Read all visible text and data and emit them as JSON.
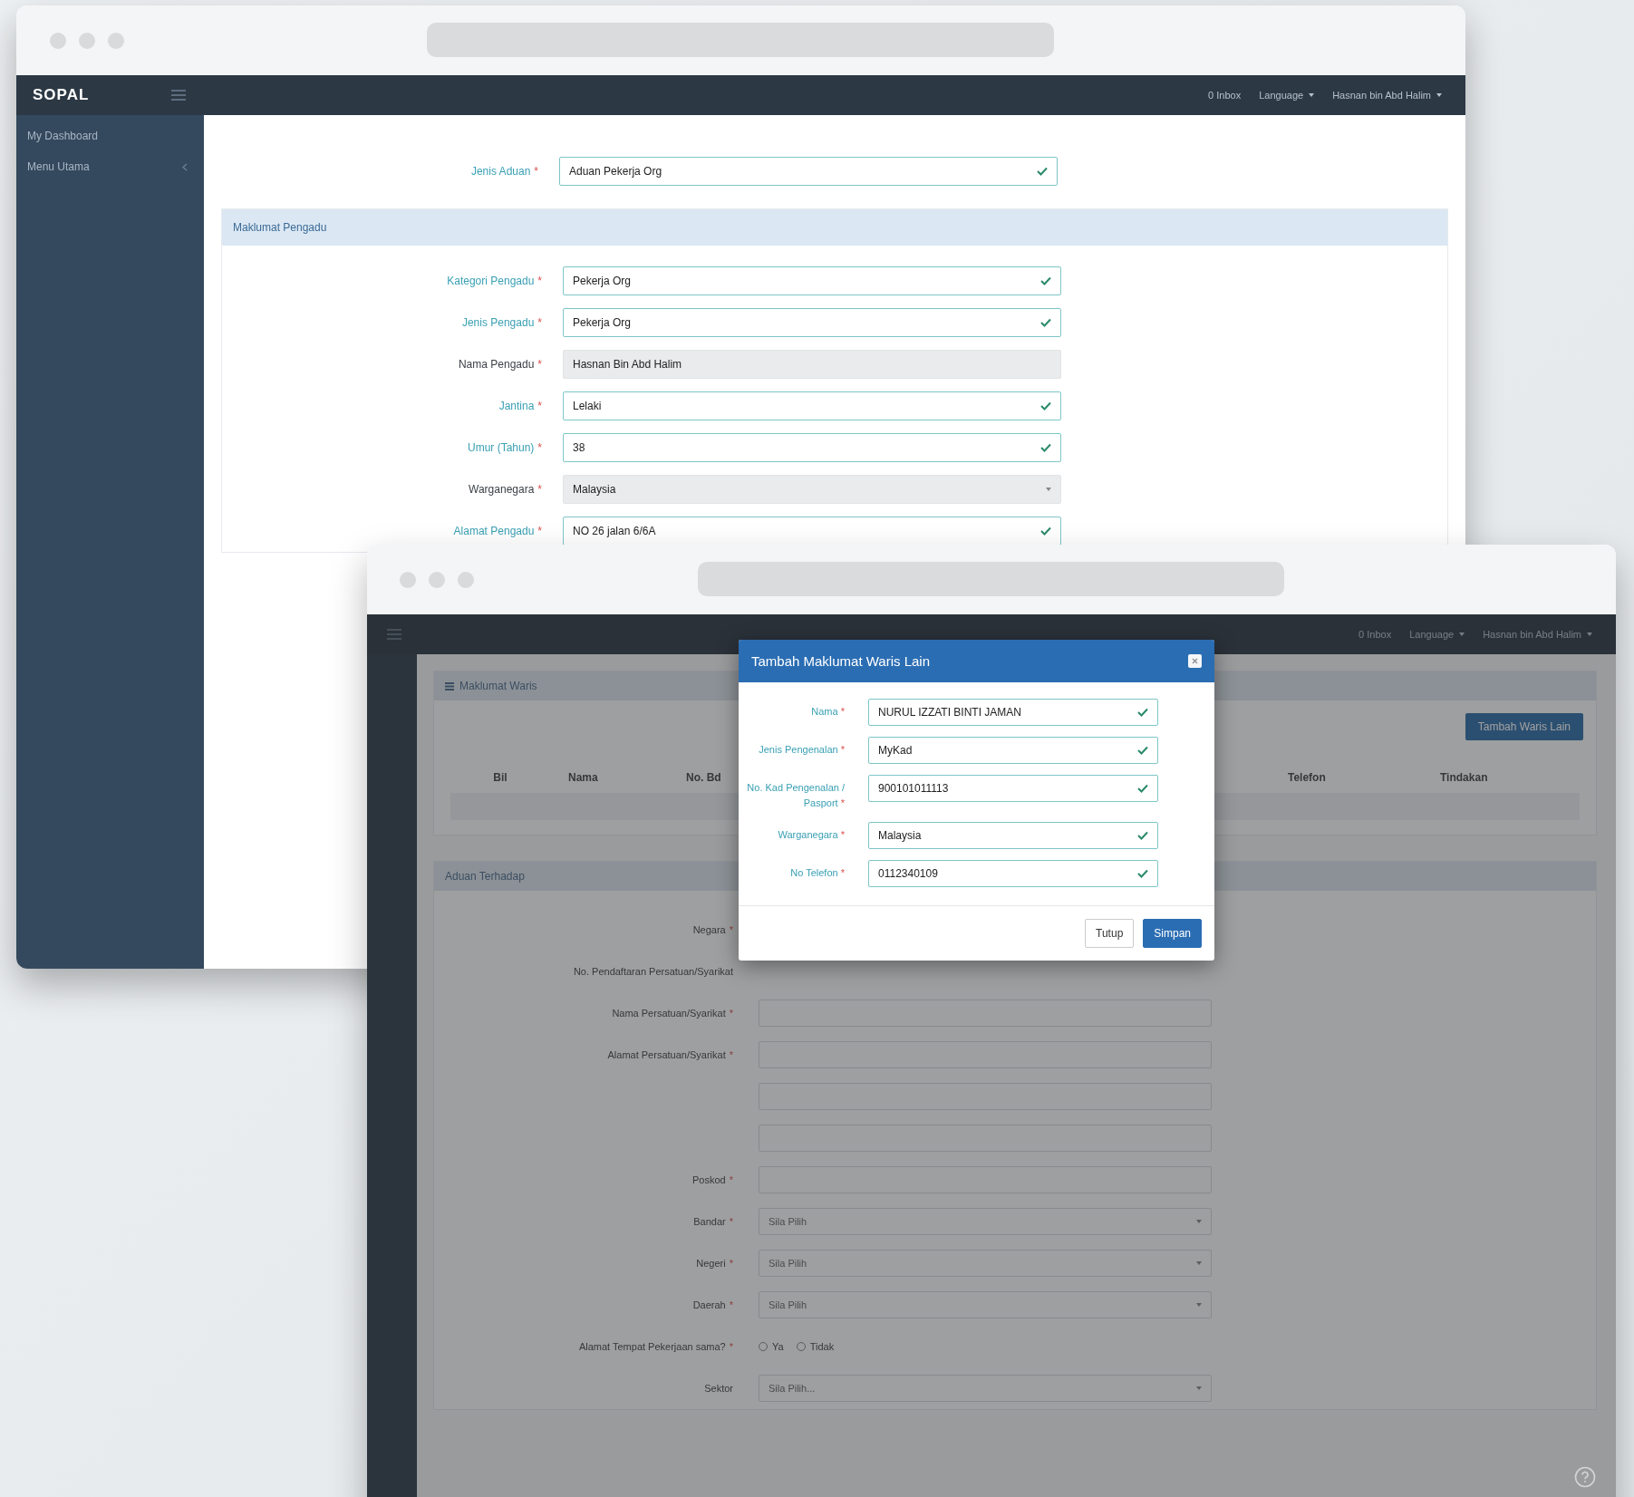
{
  "back_window": {
    "logo": "SOPAL",
    "nav": [
      {
        "label": "0 Inbox",
        "dropdown": false
      },
      {
        "label": "Language",
        "dropdown": true
      },
      {
        "label": "Hasnan bin Abd Halim",
        "dropdown": true
      }
    ],
    "sidebar": [
      {
        "label": "My Dashboard",
        "expandable": false
      },
      {
        "label": "Menu Utama",
        "expandable": true
      }
    ],
    "top_field": {
      "label": "Jenis Aduan",
      "mark": "*",
      "valid": true,
      "value": "Aduan Pekerja Org"
    },
    "section_title": "Maklumat Pengadu",
    "fields": [
      {
        "label": "Kategori Pengadu",
        "mark": "*",
        "valid": true,
        "value": "Pekerja Org"
      },
      {
        "label": "Jenis Pengadu",
        "mark": "*",
        "valid": true,
        "value": "Pekerja Org"
      },
      {
        "label": "Nama Pengadu",
        "mark": "*",
        "valid": false,
        "value": "Hasnan Bin Abd Halim"
      },
      {
        "label": "Jantina",
        "mark": "*",
        "valid": true,
        "value": "Lelaki"
      },
      {
        "label": "Umur (Tahun)",
        "mark": "*",
        "valid": true,
        "value": "38"
      },
      {
        "label": "Warganegara",
        "mark": "*",
        "valid": false,
        "dropdown": true,
        "value": "Malaysia"
      },
      {
        "label": "Alamat Pengadu",
        "mark": "*",
        "valid": true,
        "value": "NO 26 jalan 6/6A"
      }
    ]
  },
  "front_window": {
    "nav": [
      {
        "label": "0 Inbox",
        "dropdown": false
      },
      {
        "label": "Language",
        "dropdown": true
      },
      {
        "label": "Hasnan bin Abd Halim",
        "dropdown": true
      }
    ],
    "panel_title": "Maklumat Waris",
    "add_button": "Tambah Waris Lain",
    "table_columns": [
      "Bil",
      "Nama",
      "No. Bd",
      "Telefon",
      "Tindakan"
    ],
    "section_title": "Aduan Terhadap",
    "fields": [
      {
        "kind": "label",
        "label": "Negara",
        "mark": "*"
      },
      {
        "kind": "label",
        "label": "No. Pendaftaran Persatuan/Syarikat"
      },
      {
        "kind": "input",
        "label": "Nama Persatuan/Syarikat",
        "mark": "*"
      },
      {
        "kind": "input",
        "label": "Alamat Persatuan/Syarikat",
        "mark": "*"
      },
      {
        "kind": "input"
      },
      {
        "kind": "input"
      },
      {
        "kind": "input",
        "label": "Poskod",
        "mark": "*"
      },
      {
        "kind": "select",
        "label": "Bandar",
        "mark": "*",
        "placeholder": "Sila Pilih"
      },
      {
        "kind": "select",
        "label": "Negeri",
        "mark": "*",
        "placeholder": "Sila Pilih"
      },
      {
        "kind": "select",
        "label": "Daerah",
        "mark": "*",
        "placeholder": "Sila Pilih"
      },
      {
        "kind": "radio",
        "label": "Alamat Tempat Pekerjaan sama?",
        "mark": "*",
        "options": [
          {
            "label": "Ya",
            "selected": false
          },
          {
            "label": "Tidak",
            "selected": false
          }
        ]
      },
      {
        "kind": "select",
        "label": "Sektor",
        "placeholder": "Sila Pilih..."
      }
    ]
  },
  "modal": {
    "title": "Tambah Maklumat Waris Lain",
    "fields": [
      {
        "label": "Nama",
        "mark": "*",
        "valid": true,
        "value": "NURUL IZZATI BINTI JAMAN"
      },
      {
        "label": "Jenis Pengenalan",
        "mark": "*",
        "valid": true,
        "value": "MyKad"
      },
      {
        "label": "No. Kad Pengenalan / Pasport",
        "mark": "*",
        "valid": true,
        "value": "900101011113"
      },
      {
        "label": "Warganegara",
        "mark": "*",
        "valid": true,
        "value": "Malaysia"
      },
      {
        "label": "No Telefon",
        "mark": "*",
        "valid": true,
        "value": "0112340109"
      }
    ],
    "buttons": [
      {
        "label": "Tutup",
        "kind": "default"
      },
      {
        "label": "Simpan",
        "kind": "primary"
      }
    ]
  }
}
